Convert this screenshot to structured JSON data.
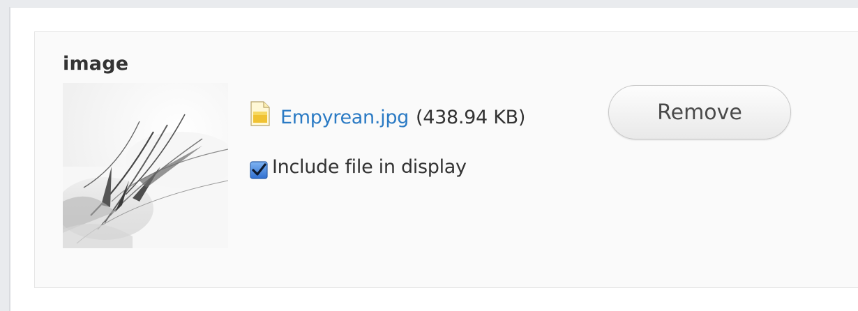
{
  "field": {
    "label": "image"
  },
  "file": {
    "name": "Empyrean.jpg",
    "size": "(438.94 KB)",
    "icon": "image-file-icon",
    "thumbnail_icon": "abstract-artwork-thumbnail"
  },
  "actions": {
    "remove_label": "Remove"
  },
  "display_option": {
    "label": "Include file in display",
    "checked": true
  },
  "colors": {
    "link": "#2a7ac4",
    "checkbox_accent": "#2f6fd0"
  }
}
